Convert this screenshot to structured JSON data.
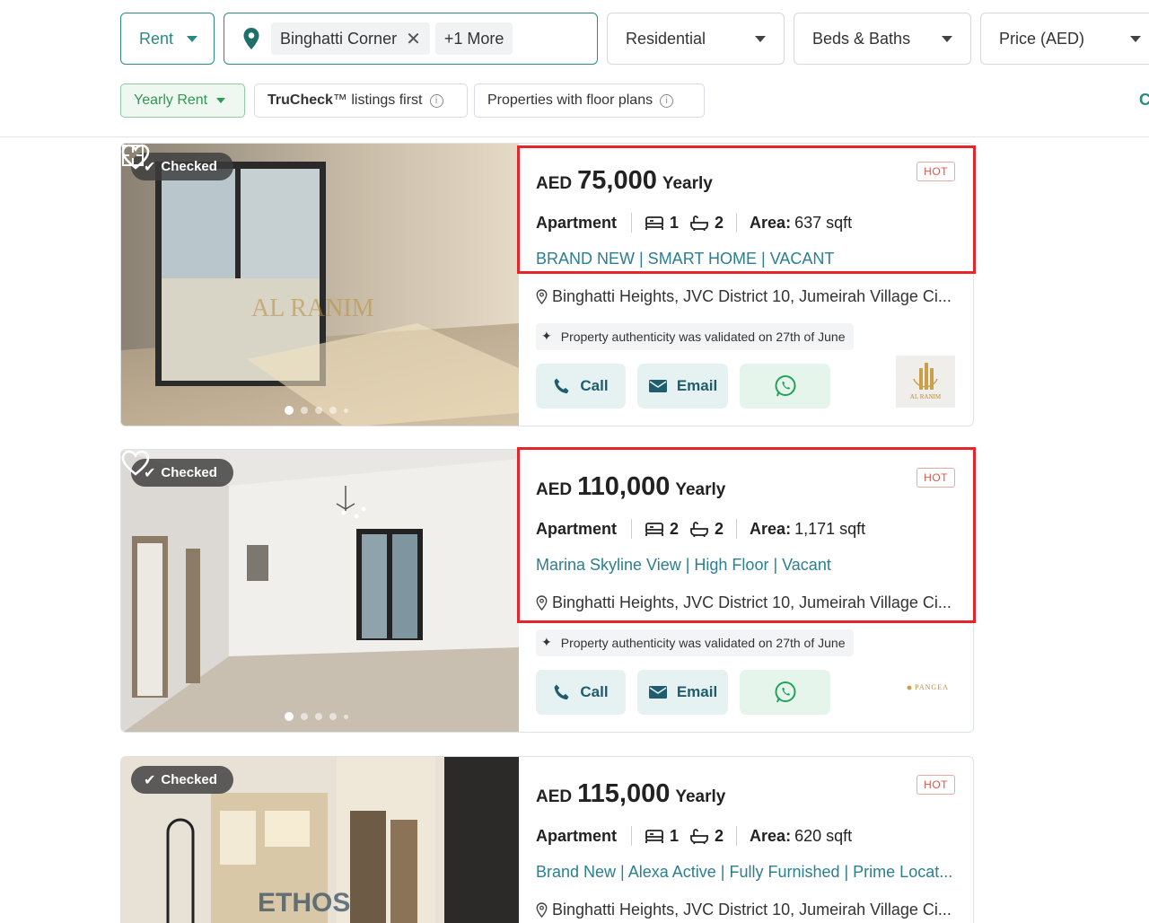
{
  "filters": {
    "purpose": "Rent",
    "location_chip": "Binghatti Corner",
    "more_chip": "+1 More",
    "property_type": "Residential",
    "beds_baths": "Beds & Baths",
    "price": "Price (AED)",
    "rent_frequency": "Yearly Rent",
    "trucheck_prefix": "TruCheck",
    "trucheck_suffix": "™ listings first",
    "floor_plans": "Properties with floor plans",
    "edge_text": "C"
  },
  "listings": [
    {
      "badge": "Checked",
      "currency": "AED",
      "price": "75,000",
      "period": "Yearly",
      "hot": "HOT",
      "type": "Apartment",
      "beds": "1",
      "baths": "2",
      "area_label": "Area:",
      "area": "637 sqft",
      "headline": "BRAND NEW | SMART HOME | VACANT",
      "address": "Binghatti Heights, JVC District 10, Jumeirah Village Ci...",
      "validated": "Property authenticity was validated on 27th of June",
      "call": "Call",
      "email": "Email",
      "agency": "AL RANIM",
      "watermark": "AL RANIM"
    },
    {
      "badge": "Checked",
      "currency": "AED",
      "price": "110,000",
      "period": "Yearly",
      "hot": "HOT",
      "type": "Apartment",
      "beds": "2",
      "baths": "2",
      "area_label": "Area:",
      "area": "1,171 sqft",
      "headline": "Marina Skyline View | High Floor | Vacant",
      "address": "Binghatti Heights, JVC District 10, Jumeirah Village Ci...",
      "validated": "Property authenticity was validated on 27th of June",
      "call": "Call",
      "email": "Email",
      "agency": "PANGEA"
    },
    {
      "badge": "Checked",
      "currency": "AED",
      "price": "115,000",
      "period": "Yearly",
      "hot": "HOT",
      "type": "Apartment",
      "beds": "1",
      "baths": "2",
      "area_label": "Area:",
      "area": "620 sqft",
      "headline": "Brand New | Alexa Active | Fully Furnished | Prime Locat...",
      "address": "Binghatti Heights, JVC District 10, Jumeirah Village Ci...",
      "watermark": "ETHOS"
    }
  ],
  "colors": {
    "brand_teal": "#2a8a83",
    "headline_link": "#2a7f90",
    "highlight_red": "#e5252a",
    "hot_red": "#d9574b",
    "yearly_green": "#2e9a52"
  }
}
